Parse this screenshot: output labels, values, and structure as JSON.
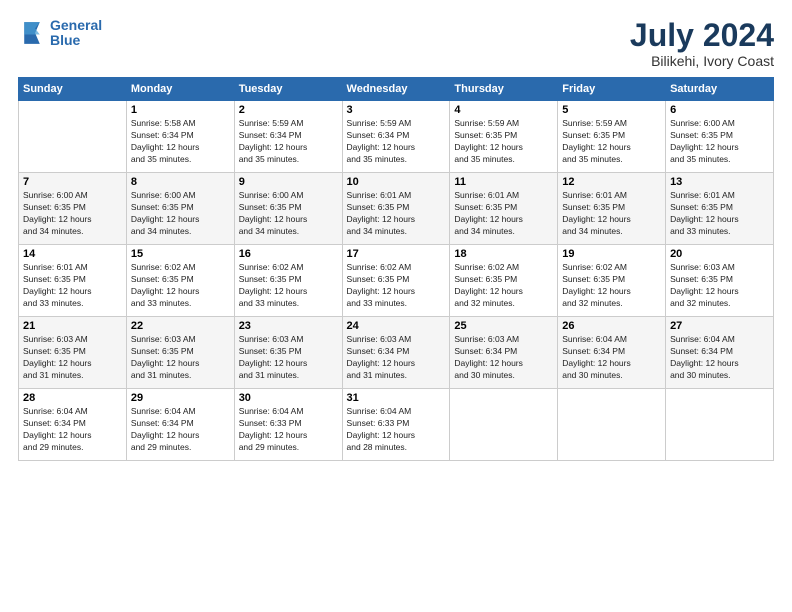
{
  "logo": {
    "line1": "General",
    "line2": "Blue"
  },
  "title": "July 2024",
  "subtitle": "Bilikehi, Ivory Coast",
  "days_header": [
    "Sunday",
    "Monday",
    "Tuesday",
    "Wednesday",
    "Thursday",
    "Friday",
    "Saturday"
  ],
  "weeks": [
    [
      {
        "day": "",
        "info": ""
      },
      {
        "day": "1",
        "info": "Sunrise: 5:58 AM\nSunset: 6:34 PM\nDaylight: 12 hours\nand 35 minutes."
      },
      {
        "day": "2",
        "info": "Sunrise: 5:59 AM\nSunset: 6:34 PM\nDaylight: 12 hours\nand 35 minutes."
      },
      {
        "day": "3",
        "info": "Sunrise: 5:59 AM\nSunset: 6:34 PM\nDaylight: 12 hours\nand 35 minutes."
      },
      {
        "day": "4",
        "info": "Sunrise: 5:59 AM\nSunset: 6:35 PM\nDaylight: 12 hours\nand 35 minutes."
      },
      {
        "day": "5",
        "info": "Sunrise: 5:59 AM\nSunset: 6:35 PM\nDaylight: 12 hours\nand 35 minutes."
      },
      {
        "day": "6",
        "info": "Sunrise: 6:00 AM\nSunset: 6:35 PM\nDaylight: 12 hours\nand 35 minutes."
      }
    ],
    [
      {
        "day": "7",
        "info": "Sunrise: 6:00 AM\nSunset: 6:35 PM\nDaylight: 12 hours\nand 34 minutes."
      },
      {
        "day": "8",
        "info": "Sunrise: 6:00 AM\nSunset: 6:35 PM\nDaylight: 12 hours\nand 34 minutes."
      },
      {
        "day": "9",
        "info": "Sunrise: 6:00 AM\nSunset: 6:35 PM\nDaylight: 12 hours\nand 34 minutes."
      },
      {
        "day": "10",
        "info": "Sunrise: 6:01 AM\nSunset: 6:35 PM\nDaylight: 12 hours\nand 34 minutes."
      },
      {
        "day": "11",
        "info": "Sunrise: 6:01 AM\nSunset: 6:35 PM\nDaylight: 12 hours\nand 34 minutes."
      },
      {
        "day": "12",
        "info": "Sunrise: 6:01 AM\nSunset: 6:35 PM\nDaylight: 12 hours\nand 34 minutes."
      },
      {
        "day": "13",
        "info": "Sunrise: 6:01 AM\nSunset: 6:35 PM\nDaylight: 12 hours\nand 33 minutes."
      }
    ],
    [
      {
        "day": "14",
        "info": "Sunrise: 6:01 AM\nSunset: 6:35 PM\nDaylight: 12 hours\nand 33 minutes."
      },
      {
        "day": "15",
        "info": "Sunrise: 6:02 AM\nSunset: 6:35 PM\nDaylight: 12 hours\nand 33 minutes."
      },
      {
        "day": "16",
        "info": "Sunrise: 6:02 AM\nSunset: 6:35 PM\nDaylight: 12 hours\nand 33 minutes."
      },
      {
        "day": "17",
        "info": "Sunrise: 6:02 AM\nSunset: 6:35 PM\nDaylight: 12 hours\nand 33 minutes."
      },
      {
        "day": "18",
        "info": "Sunrise: 6:02 AM\nSunset: 6:35 PM\nDaylight: 12 hours\nand 32 minutes."
      },
      {
        "day": "19",
        "info": "Sunrise: 6:02 AM\nSunset: 6:35 PM\nDaylight: 12 hours\nand 32 minutes."
      },
      {
        "day": "20",
        "info": "Sunrise: 6:03 AM\nSunset: 6:35 PM\nDaylight: 12 hours\nand 32 minutes."
      }
    ],
    [
      {
        "day": "21",
        "info": "Sunrise: 6:03 AM\nSunset: 6:35 PM\nDaylight: 12 hours\nand 31 minutes."
      },
      {
        "day": "22",
        "info": "Sunrise: 6:03 AM\nSunset: 6:35 PM\nDaylight: 12 hours\nand 31 minutes."
      },
      {
        "day": "23",
        "info": "Sunrise: 6:03 AM\nSunset: 6:35 PM\nDaylight: 12 hours\nand 31 minutes."
      },
      {
        "day": "24",
        "info": "Sunrise: 6:03 AM\nSunset: 6:34 PM\nDaylight: 12 hours\nand 31 minutes."
      },
      {
        "day": "25",
        "info": "Sunrise: 6:03 AM\nSunset: 6:34 PM\nDaylight: 12 hours\nand 30 minutes."
      },
      {
        "day": "26",
        "info": "Sunrise: 6:04 AM\nSunset: 6:34 PM\nDaylight: 12 hours\nand 30 minutes."
      },
      {
        "day": "27",
        "info": "Sunrise: 6:04 AM\nSunset: 6:34 PM\nDaylight: 12 hours\nand 30 minutes."
      }
    ],
    [
      {
        "day": "28",
        "info": "Sunrise: 6:04 AM\nSunset: 6:34 PM\nDaylight: 12 hours\nand 29 minutes."
      },
      {
        "day": "29",
        "info": "Sunrise: 6:04 AM\nSunset: 6:34 PM\nDaylight: 12 hours\nand 29 minutes."
      },
      {
        "day": "30",
        "info": "Sunrise: 6:04 AM\nSunset: 6:33 PM\nDaylight: 12 hours\nand 29 minutes."
      },
      {
        "day": "31",
        "info": "Sunrise: 6:04 AM\nSunset: 6:33 PM\nDaylight: 12 hours\nand 28 minutes."
      },
      {
        "day": "",
        "info": ""
      },
      {
        "day": "",
        "info": ""
      },
      {
        "day": "",
        "info": ""
      }
    ]
  ]
}
